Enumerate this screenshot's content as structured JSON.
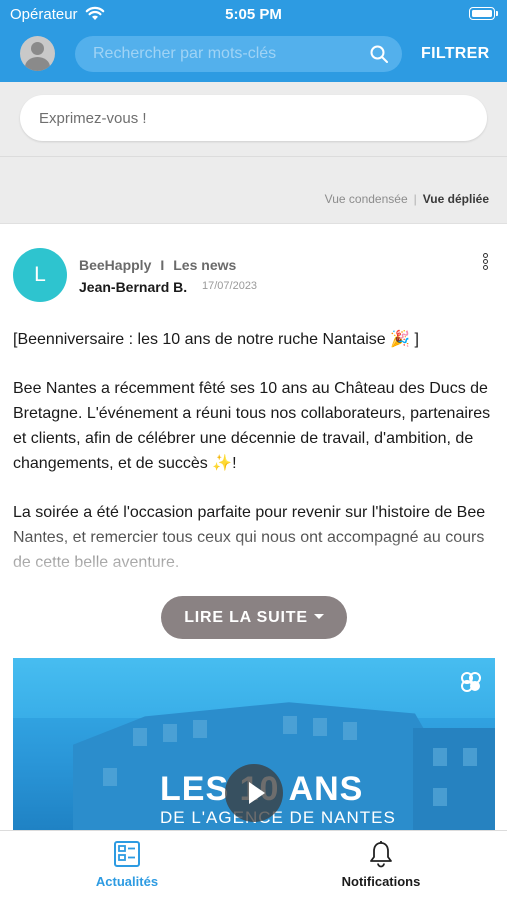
{
  "status_bar": {
    "carrier": "Opérateur",
    "time": "5:05 PM"
  },
  "header": {
    "search_placeholder": "Rechercher par mots-clés",
    "filter_label": "FILTRER",
    "accent_color": "#2d9be2"
  },
  "composer": {
    "placeholder": "Exprimez-vous !"
  },
  "view_toggle": {
    "condensed": "Vue condensée",
    "expanded": "Vue dépliée",
    "active": "expanded"
  },
  "post": {
    "avatar_letter": "L",
    "avatar_color": "#2ec4cf",
    "community": "BeeHapply",
    "channel": "Les news",
    "author": "Jean-Bernard B.",
    "date": "17/07/2023",
    "paragraphs": [
      "[Beenniversaire : les 10 ans de notre ruche Nantaise 🎉 ]",
      "Bee Nantes a récemment fêté ses 10 ans au Château des Ducs de Bretagne. L'événement a réuni tous nos collaborateurs, partenaires et clients, afin de célébrer une décennie de travail, d'ambition, de changements, et de succès ✨!",
      "La soirée a été l'occasion parfaite pour revenir sur l'histoire de Bee Nantes, et remercier tous ceux qui nous ont accompagné au cours de cette belle aventure."
    ],
    "read_more_label": "LIRE LA SUITE",
    "video": {
      "title": "LES 10 ANS",
      "subtitle": "DE L'AGENCE DE NANTES"
    }
  },
  "tabbar": {
    "tabs": [
      {
        "label": "Actualités",
        "icon": "newspaper-icon",
        "active": true
      },
      {
        "label": "Notifications",
        "icon": "bell-icon",
        "active": false
      }
    ]
  }
}
